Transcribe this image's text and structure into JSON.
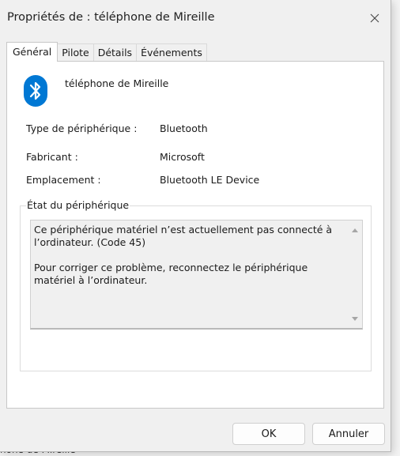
{
  "window": {
    "title": "Propriétés de : téléphone de Mireille"
  },
  "background": {
    "partial_text": "hone de Mireille"
  },
  "tabs": [
    {
      "label": "Général",
      "active": true
    },
    {
      "label": "Pilote",
      "active": false
    },
    {
      "label": "Détails",
      "active": false
    },
    {
      "label": "Événements",
      "active": false
    }
  ],
  "device": {
    "icon": "bluetooth-icon",
    "name": "téléphone de Mireille"
  },
  "properties": [
    {
      "label": "Type de périphérique :",
      "value": "Bluetooth"
    },
    {
      "label": "Fabricant :",
      "value": "Microsoft"
    },
    {
      "label": "Emplacement :",
      "value": "Bluetooth LE Device"
    }
  ],
  "status": {
    "group_title": "État du périphérique",
    "message_line1": "Ce périphérique matériel n’est actuellement pas connecté à l’ordinateur.  (Code 45)",
    "message_line2": "Pour corriger ce problème, reconnectez le périphérique matériel à l’ordinateur."
  },
  "buttons": {
    "ok": "OK",
    "cancel": "Annuler"
  },
  "colors": {
    "bluetooth_blue": "#0078d4",
    "dialog_bg": "#f0f0f0",
    "panel_bg": "#ffffff"
  }
}
